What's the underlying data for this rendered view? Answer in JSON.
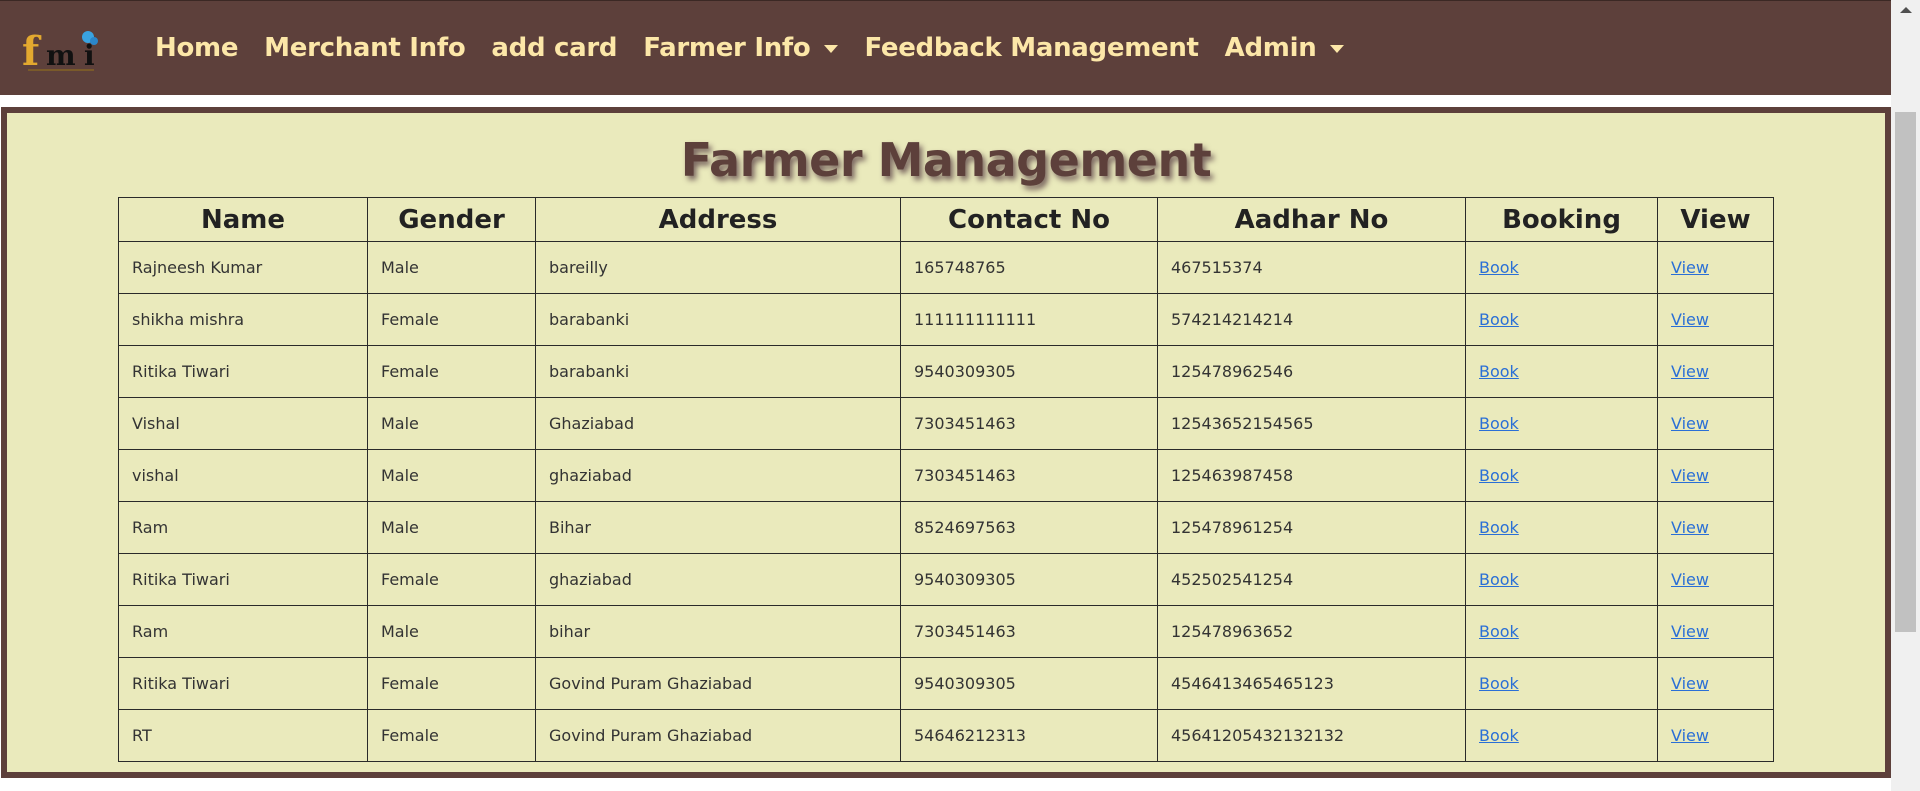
{
  "navbar": {
    "logo_alt": "fmi",
    "items": [
      {
        "label": "Home",
        "dropdown": false
      },
      {
        "label": "Merchant Info",
        "dropdown": false
      },
      {
        "label": "add card",
        "dropdown": false
      },
      {
        "label": "Farmer Info",
        "dropdown": true
      },
      {
        "label": "Feedback Management",
        "dropdown": false
      },
      {
        "label": "Admin",
        "dropdown": true
      }
    ]
  },
  "main": {
    "title": "Farmer Management",
    "columns": [
      "Name",
      "Gender",
      "Address",
      "Contact No",
      "Aadhar No",
      "Booking",
      "View"
    ],
    "rows": [
      {
        "name": "Rajneesh Kumar",
        "gender": "Male",
        "address": "bareilly",
        "contact": "165748765",
        "aadhar": "467515374",
        "booking": "Book",
        "view": "View"
      },
      {
        "name": "shikha mishra",
        "gender": "Female",
        "address": "barabanki",
        "contact": "111111111111",
        "aadhar": "574214214214",
        "booking": "Book",
        "view": "View"
      },
      {
        "name": "Ritika Tiwari",
        "gender": "Female",
        "address": "barabanki",
        "contact": "9540309305",
        "aadhar": "125478962546",
        "booking": "Book",
        "view": "View"
      },
      {
        "name": "Vishal",
        "gender": "Male",
        "address": "Ghaziabad",
        "contact": "7303451463",
        "aadhar": "12543652154565",
        "booking": "Book",
        "view": "View"
      },
      {
        "name": "vishal",
        "gender": "Male",
        "address": "ghaziabad",
        "contact": "7303451463",
        "aadhar": "125463987458",
        "booking": "Book",
        "view": "View"
      },
      {
        "name": "Ram",
        "gender": "Male",
        "address": "Bihar",
        "contact": "8524697563",
        "aadhar": "125478961254",
        "booking": "Book",
        "view": "View"
      },
      {
        "name": "Ritika Tiwari",
        "gender": "Female",
        "address": "ghaziabad",
        "contact": "9540309305",
        "aadhar": "452502541254",
        "booking": "Book",
        "view": "View"
      },
      {
        "name": "Ram",
        "gender": "Male",
        "address": "bihar",
        "contact": "7303451463",
        "aadhar": "125478963652",
        "booking": "Book",
        "view": "View"
      },
      {
        "name": "Ritika Tiwari",
        "gender": "Female",
        "address": "Govind Puram Ghaziabad",
        "contact": "9540309305",
        "aadhar": "4546413465465123",
        "booking": "Book",
        "view": "View"
      },
      {
        "name": "RT",
        "gender": "Female",
        "address": "Govind Puram Ghaziabad",
        "contact": "54646212313",
        "aadhar": "45641205432132132",
        "booking": "Book",
        "view": "View"
      }
    ]
  },
  "colors": {
    "navbar_bg": "#5d403b",
    "nav_text": "#fce7a8",
    "panel_bg": "#eaeabc",
    "link": "#2a6fd6"
  }
}
